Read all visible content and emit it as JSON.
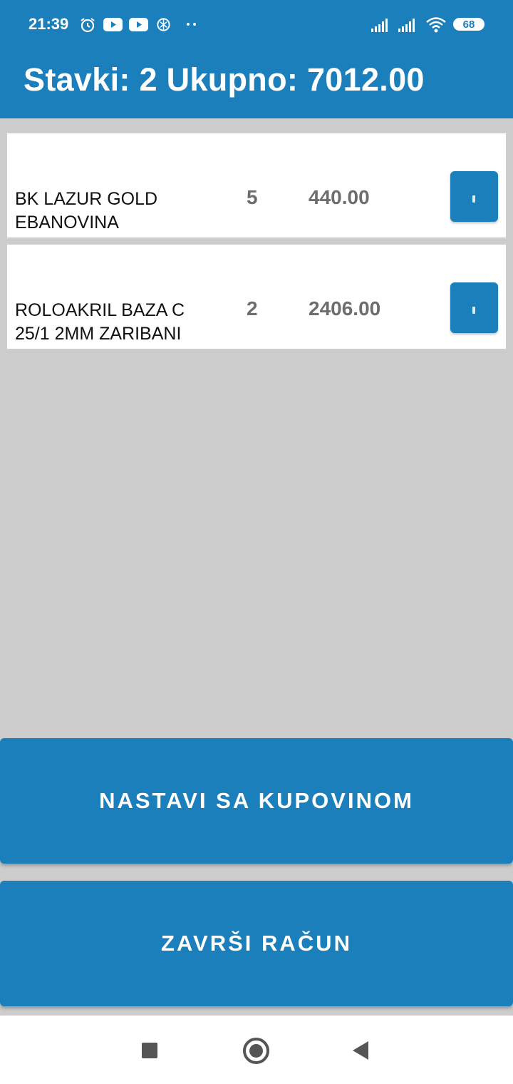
{
  "status_bar": {
    "time": "21:39",
    "battery": "68",
    "icons": [
      "alarm-icon",
      "youtube-icon",
      "youtube-icon",
      "openai-icon",
      "more-dots-icon",
      "signal-icon",
      "signal-icon",
      "wifi-icon",
      "battery-icon"
    ]
  },
  "header": {
    "title": "Stavki: 2 Ukupno: 7012.00"
  },
  "items": [
    {
      "name": "BK LAZUR GOLD EBANOVINA",
      "qty": "5",
      "price": "440.00",
      "remove_icon": "close-icon"
    },
    {
      "name": "ROLOAKRIL BAZA C 25/1 2MM ZARIBANI",
      "qty": "2",
      "price": "2406.00",
      "remove_icon": "close-icon"
    }
  ],
  "actions": {
    "continue_label": "NASTAVI SA KUPOVINOM",
    "finish_label": "ZAVRŠI RAČUN"
  },
  "nav": {
    "icons": [
      "recents-square-icon",
      "home-circle-icon",
      "back-triangle-icon"
    ]
  },
  "colors": {
    "primary": "#1a7fbb",
    "background": "#cdcdcd",
    "text_secondary": "#6d6d6d"
  }
}
